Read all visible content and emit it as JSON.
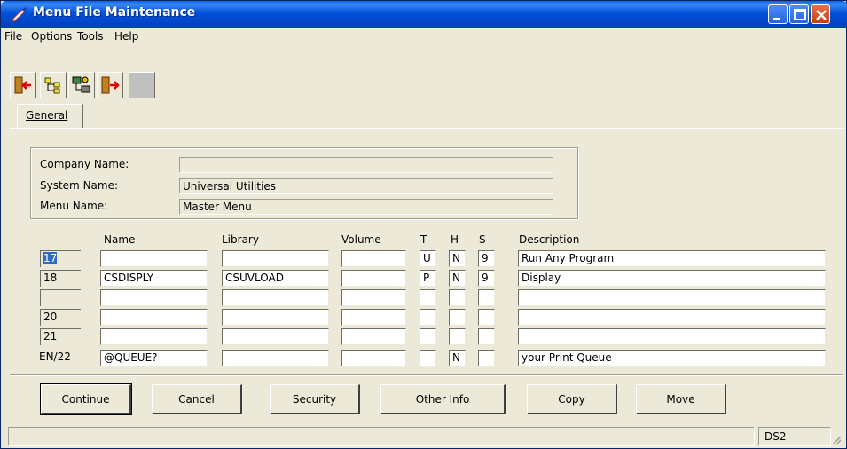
{
  "window": {
    "title": "Menu File Maintenance"
  },
  "menubar": {
    "items": [
      "File",
      "Options",
      "Tools",
      "Help"
    ]
  },
  "toolbar": {
    "icons": [
      "exit-icon",
      "tree-icon",
      "network-icon",
      "next-icon",
      "blank-icon"
    ]
  },
  "tabs": [
    {
      "label": "General",
      "active": true
    }
  ],
  "header": {
    "company_label": "Company Name:",
    "company_value": "",
    "system_label": "System Name:",
    "system_value": "Universal Utilities",
    "menu_label": "Menu Name:",
    "menu_value": "Master Menu"
  },
  "grid": {
    "columns": {
      "name": "Name",
      "library": "Library",
      "volume": "Volume",
      "t": "T",
      "h": "H",
      "s": "S",
      "description": "Description"
    },
    "rows": [
      {
        "label": "17",
        "name": "",
        "library": "",
        "volume": "",
        "t": "U",
        "h": "N",
        "s": "9",
        "description": "Run Any Program"
      },
      {
        "label": "18",
        "name": "CSDISPLY",
        "library": "CSUVLOAD",
        "volume": "",
        "t": "P",
        "h": "N",
        "s": "9",
        "description": "Display"
      },
      {
        "label": "",
        "name": "",
        "library": "",
        "volume": "",
        "t": "",
        "h": "",
        "s": "",
        "description": ""
      },
      {
        "label": "20",
        "name": "",
        "library": "",
        "volume": "",
        "t": "",
        "h": "",
        "s": "",
        "description": ""
      },
      {
        "label": "21",
        "name": "",
        "library": "",
        "volume": "",
        "t": "",
        "h": "",
        "s": "",
        "description": ""
      },
      {
        "label": "EN/22",
        "name": "@QUEUE?",
        "library": "",
        "volume": "",
        "t": "",
        "h": "N",
        "s": "",
        "description": "your Print Queue"
      }
    ]
  },
  "buttons": {
    "continue": "Continue",
    "cancel": "Cancel",
    "security": "Security",
    "other_info": "Other Info",
    "copy": "Copy",
    "move": "Move"
  },
  "status": {
    "right": "DS2"
  },
  "colors": {
    "titlebar": "#0050d8",
    "face": "#ece9d8",
    "selection": "#316ac5"
  }
}
